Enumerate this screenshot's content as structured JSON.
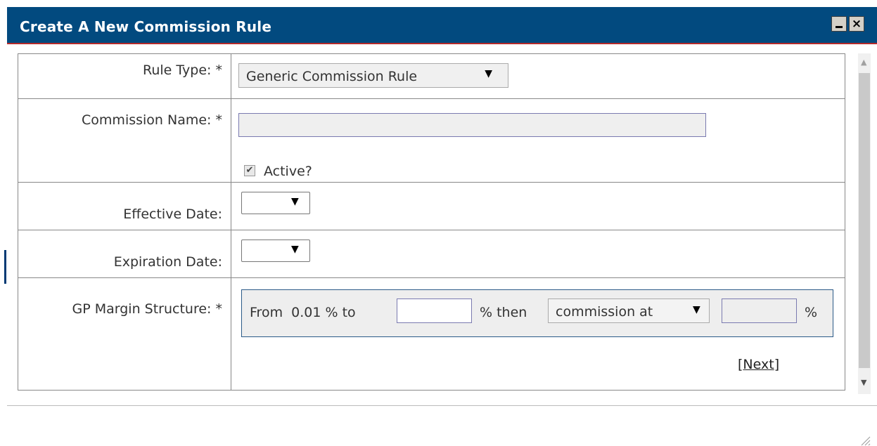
{
  "dialog": {
    "title": "Create A New Commission Rule",
    "minimize_icon": "minimize-icon",
    "close_icon": "close-icon",
    "close_glyph": "×"
  },
  "form": {
    "rule_type": {
      "label": "Rule Type: *",
      "selected": "Generic Commission Rule"
    },
    "commission_name": {
      "label": "Commission Name: *",
      "value": "",
      "active_label": "Active?",
      "active_checked": true,
      "check_glyph": "✔"
    },
    "effective_date": {
      "label": "Effective Date:",
      "selected": ""
    },
    "expiration_date": {
      "label": "Expiration Date:",
      "selected": ""
    },
    "gp_margin": {
      "label": "GP Margin Structure: *",
      "from_text": "From  0.01 % to",
      "to_value": "",
      "then_text": "% then",
      "mode_selected": "commission at",
      "rate_value": "",
      "percent": "%",
      "next_open": "[",
      "next_label": "Next",
      "next_close": "]"
    }
  },
  "dropdown_glyph": "▼",
  "scroll_up_glyph": "▲",
  "scroll_down_glyph": "▼",
  "colors": {
    "titlebar": "#024a7f",
    "accent_border": "#2b5a88"
  }
}
